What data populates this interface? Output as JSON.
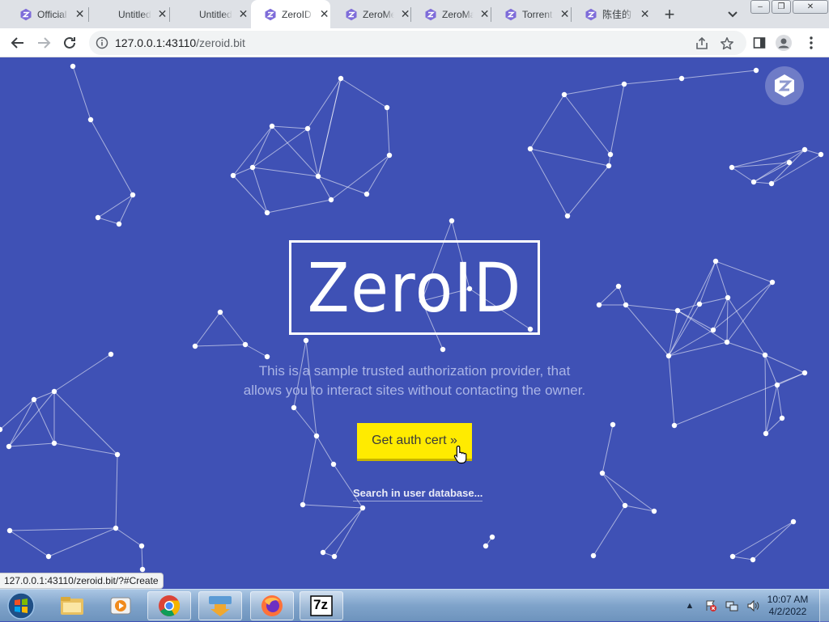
{
  "browser": {
    "tabs": [
      {
        "title": "Official",
        "favicon": "zeronet-icon",
        "active": false
      },
      {
        "title": "Untitled",
        "favicon": null,
        "active": false
      },
      {
        "title": "Untitled",
        "favicon": null,
        "active": false
      },
      {
        "title": "ZeroID",
        "favicon": "zeronet-icon",
        "active": true
      },
      {
        "title": "ZeroMe",
        "favicon": "zeronet-icon",
        "active": false
      },
      {
        "title": "ZeroMail",
        "favicon": "zeronet-icon",
        "active": false
      },
      {
        "title": "Torrent",
        "favicon": "zeronet-icon",
        "active": false
      },
      {
        "title": "陈佳的",
        "favicon": "zeronet-icon",
        "active": false
      }
    ],
    "new_tab_label": "+",
    "window_buttons": {
      "minimize": "–",
      "restore": "❐",
      "close": "✕"
    },
    "url_host": "127.0.0.1:43110",
    "url_path": "/zeroid.bit",
    "status_url": "127.0.0.1:43110/zeroid.bit/?#Create"
  },
  "page": {
    "brand_title": "ZeroID",
    "tagline_line1": "This is a sample trusted authorization provider, that",
    "tagline_line2": "allows you to interact sites without contacting the owner.",
    "cta_label": "Get auth cert »",
    "search_link": "Search in user database...",
    "colors": {
      "background": "#3f51b5",
      "button": "#ffeb00",
      "text": "#ffffff"
    }
  },
  "taskbar": {
    "apps": [
      "windows-explorer-icon",
      "media-player-icon",
      "chrome-icon",
      "downloader-icon",
      "firefox-icon",
      "7zip-icon"
    ],
    "seven_zip_label": "7z",
    "tray_arrow": "▲",
    "time": "10:07 AM",
    "date": "4/2/2022"
  }
}
